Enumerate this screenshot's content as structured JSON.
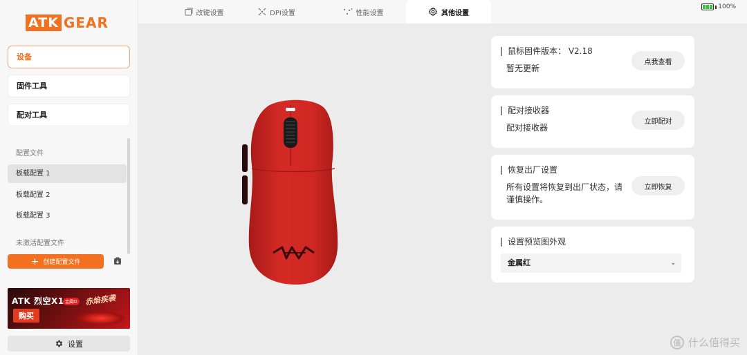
{
  "logo": {
    "atk": "ATK",
    "gear": "GEAR"
  },
  "sidebar": {
    "nav": [
      {
        "label": "设备"
      },
      {
        "label": "固件工具"
      },
      {
        "label": "配对工具"
      }
    ],
    "profiles_header": "配置文件",
    "profiles": [
      {
        "label": "板载配置 1"
      },
      {
        "label": "板载配置 2"
      },
      {
        "label": "板载配置 3"
      }
    ],
    "inactive_label": "未激活配置文件",
    "create_label": "创建配置文件",
    "banner": {
      "title": "ATK 烈空X1",
      "tag": "金属红",
      "slogan": "赤焰疾袭",
      "buy": "购买"
    },
    "settings_label": "设置"
  },
  "tabs": [
    {
      "label": "改键设置",
      "icon": "keymap-icon"
    },
    {
      "label": "DPI设置",
      "icon": "dpi-icon"
    },
    {
      "label": "性能设置",
      "icon": "performance-icon"
    },
    {
      "label": "其他设置",
      "icon": "gear-icon"
    }
  ],
  "battery": {
    "level": 100,
    "text": "100%"
  },
  "cards": {
    "firmware": {
      "title": "鼠标固件版本：  V2.18",
      "sub": "暂无更新",
      "button": "点我查看"
    },
    "pair": {
      "title": "配对接收器",
      "sub": "配对接收器",
      "button": "立即配对"
    },
    "reset": {
      "title": "恢复出厂设置",
      "sub": "所有设置将恢复到出厂状态，请谨慎操作。",
      "button": "立即恢复"
    },
    "appearance": {
      "title": "设置预览图外观",
      "selected": "金属红"
    }
  },
  "watermark": {
    "logo": "值",
    "text": "什么值得买"
  },
  "colors": {
    "accent": "#f2701f",
    "mouse": "#d42a25"
  }
}
